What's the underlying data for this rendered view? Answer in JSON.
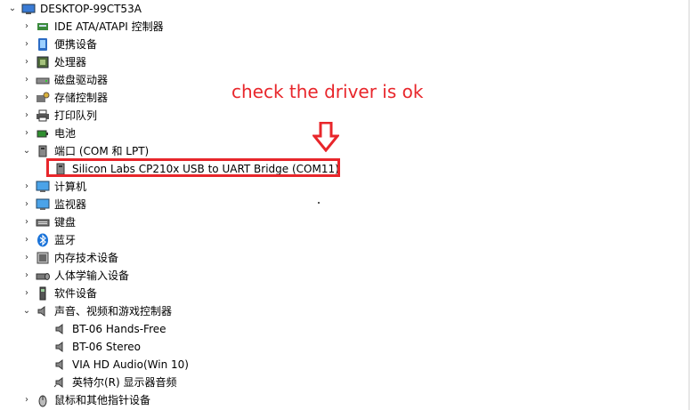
{
  "root": {
    "label": "DESKTOP-99CT53A",
    "expanded": true,
    "icon": "computer-icon"
  },
  "categories": [
    {
      "label": "IDE ATA/ATAPI 控制器",
      "icon": "ide-controller-icon",
      "expanded": false
    },
    {
      "label": "便携设备",
      "icon": "portable-device-icon",
      "expanded": false
    },
    {
      "label": "处理器",
      "icon": "processor-icon",
      "expanded": false
    },
    {
      "label": "磁盘驱动器",
      "icon": "disk-drive-icon",
      "expanded": false
    },
    {
      "label": "存储控制器",
      "icon": "storage-controller-icon",
      "expanded": false
    },
    {
      "label": "打印队列",
      "icon": "printer-icon",
      "expanded": false
    },
    {
      "label": "电池",
      "icon": "battery-icon",
      "expanded": false
    },
    {
      "label": "端口 (COM 和 LPT)",
      "icon": "port-icon",
      "expanded": true,
      "children": [
        {
          "label": "Silicon Labs CP210x USB to UART Bridge (COM11)",
          "icon": "port-icon"
        }
      ]
    },
    {
      "label": "计算机",
      "icon": "monitor-icon",
      "expanded": false
    },
    {
      "label": "监视器",
      "icon": "monitor-icon",
      "expanded": false
    },
    {
      "label": "键盘",
      "icon": "keyboard-icon",
      "expanded": false
    },
    {
      "label": "蓝牙",
      "icon": "bluetooth-icon",
      "expanded": false
    },
    {
      "label": "内存技术设备",
      "icon": "memory-icon",
      "expanded": false
    },
    {
      "label": "人体学输入设备",
      "icon": "hid-icon",
      "expanded": false
    },
    {
      "label": "软件设备",
      "icon": "software-device-icon",
      "expanded": false
    },
    {
      "label": "声音、视频和游戏控制器",
      "icon": "speaker-icon",
      "expanded": true,
      "children": [
        {
          "label": "BT-06 Hands-Free",
          "icon": "speaker-icon"
        },
        {
          "label": "BT-06 Stereo",
          "icon": "speaker-icon"
        },
        {
          "label": "VIA HD Audio(Win 10)",
          "icon": "speaker-icon"
        },
        {
          "label": "英特尔(R) 显示器音频",
          "icon": "speaker-icon"
        }
      ]
    },
    {
      "label": "鼠标和其他指针设备",
      "icon": "mouse-icon",
      "expanded": false
    }
  ],
  "annotation": {
    "text": "check the driver is ok",
    "color": "#e8262b"
  }
}
